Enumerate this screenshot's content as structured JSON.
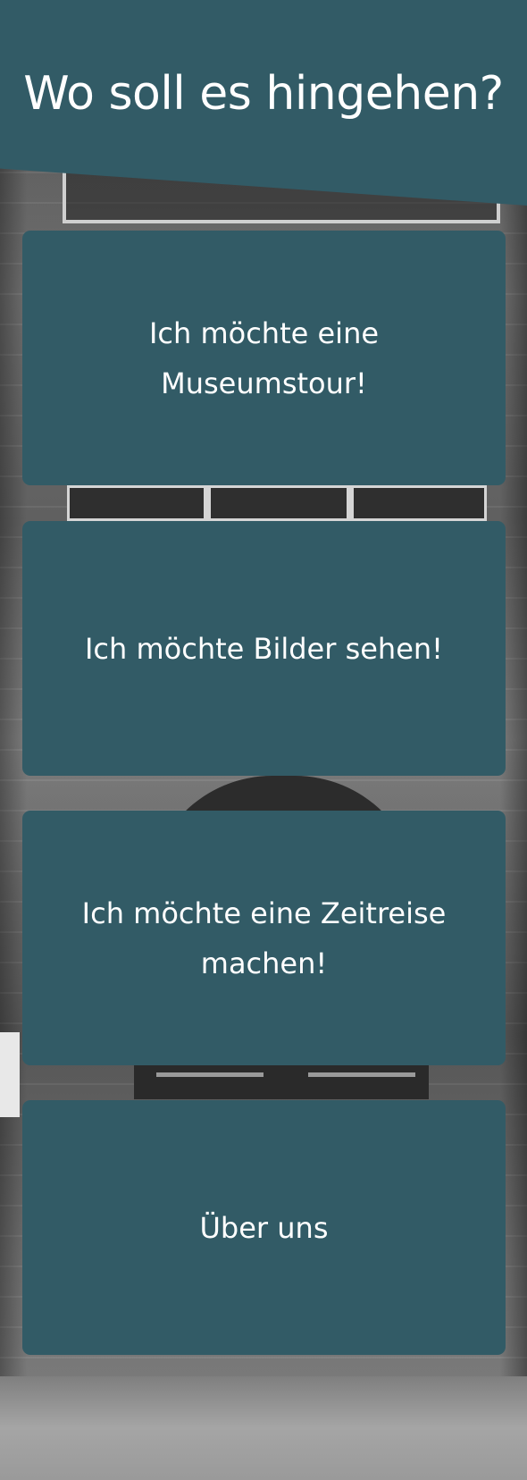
{
  "header": {
    "title": "Wo soll es hingehen?"
  },
  "menu": {
    "items": [
      {
        "label": "Ich möchte eine Museumstour!"
      },
      {
        "label": "Ich möchte Bilder sehen!"
      },
      {
        "label": "Ich möchte eine Zeitreise machen!"
      },
      {
        "label": "Über uns"
      }
    ]
  },
  "colors": {
    "accent": "#325b66",
    "text": "#ffffff"
  },
  "icons": {
    "background": "building-facade-photo"
  }
}
